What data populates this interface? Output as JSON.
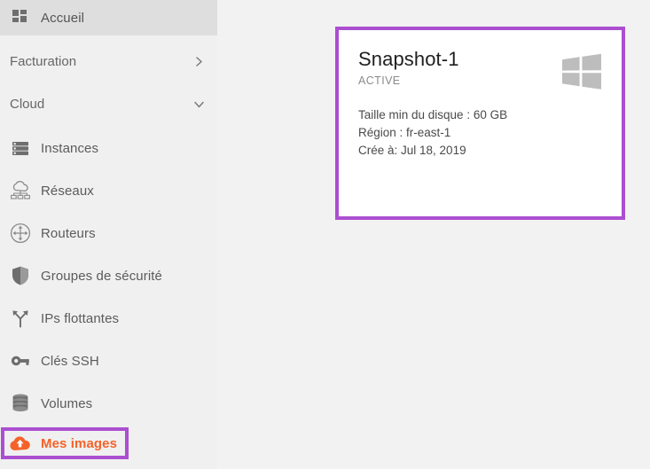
{
  "theme": {
    "sidebar_bg": "#f0f0f0",
    "active_row_bg": "#dedede",
    "content_bg": "#f2f2f2",
    "card_bg": "#ffffff",
    "highlight_purple": "#ab4fd0",
    "accent_orange": "#f4622a",
    "icon_gray": "#6e6e6e",
    "text_gray": "#5b5b5b"
  },
  "sidebar": {
    "home": {
      "label": "Accueil",
      "icon": "grid-dashboard-icon"
    },
    "sections": [
      {
        "label": "Facturation",
        "chevron": "chevron-right-icon",
        "expanded": false
      },
      {
        "label": "Cloud",
        "chevron": "chevron-down-icon",
        "expanded": true
      }
    ],
    "items": [
      {
        "label": "Instances",
        "icon": "server-stack-icon",
        "selected": false
      },
      {
        "label": "Réseaux",
        "icon": "cloud-network-icon",
        "selected": false
      },
      {
        "label": "Routeurs",
        "icon": "router-icon",
        "selected": false
      },
      {
        "label": "Groupes de sécurité",
        "icon": "shield-icon",
        "selected": false
      },
      {
        "label": "IPs flottantes",
        "icon": "branch-arrow-icon",
        "selected": false
      },
      {
        "label": "Clés SSH",
        "icon": "key-icon",
        "selected": false
      },
      {
        "label": "Volumes",
        "icon": "database-stack-icon",
        "selected": false
      },
      {
        "label": "Mes images",
        "icon": "cloud-upload-icon",
        "selected": true
      }
    ]
  },
  "main": {
    "card": {
      "title": "Snapshot-1",
      "status": "ACTIVE",
      "os_icon": "windows-logo-icon",
      "details": [
        "Taille min du disque : 60 GB",
        "Région : fr-east-1",
        "Crée à:  Jul 18, 2019"
      ]
    }
  }
}
